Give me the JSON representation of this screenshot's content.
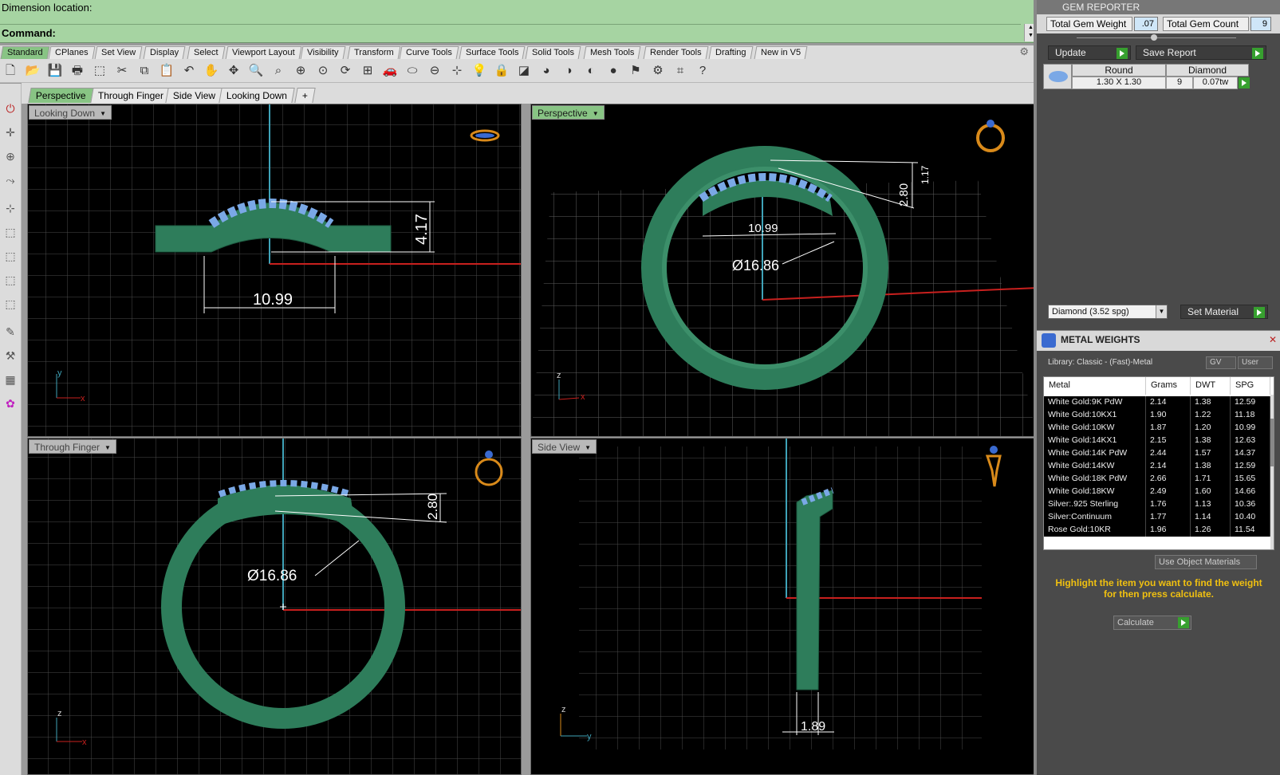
{
  "command_area": {
    "line1": "Dimension location:",
    "line2": "Command:"
  },
  "toolbar_tabs": [
    "Standard",
    "CPlanes",
    "Set View",
    "Display",
    "Select",
    "Viewport Layout",
    "Visibility",
    "Transform",
    "Curve Tools",
    "Surface Tools",
    "Solid Tools",
    "Mesh Tools",
    "Render Tools",
    "Drafting",
    "New in V5"
  ],
  "viewport_tabs": [
    "Perspective",
    "Through Finger",
    "Side View",
    "Looking Down",
    "+"
  ],
  "viewports": {
    "looking_down": {
      "label": "Looking Down",
      "dims": {
        "height": "4.17",
        "width": "10.99"
      }
    },
    "perspective": {
      "label": "Perspective",
      "dims": {
        "top": "1.17",
        "side": "2.80",
        "width": "10.99",
        "diameter": "Ø16.86"
      }
    },
    "through_finger": {
      "label": "Through Finger",
      "dims": {
        "side": "2.80",
        "diameter": "Ø16.86"
      }
    },
    "side_view": {
      "label": "Side View",
      "dims": {
        "thickness": "1.89"
      }
    }
  },
  "gem_reporter": {
    "title": "GEM REPORTER",
    "total_gem_weight_label": "Total Gem Weight",
    "total_gem_weight_value": ".07",
    "total_gem_count_label": "Total Gem Count",
    "total_gem_count_value": "9",
    "update_label": "Update",
    "save_report_label": "Save Report",
    "table_headers": [
      "Round",
      "Diamond"
    ],
    "row": {
      "size": "1.30 X 1.30",
      "count": "9",
      "weight": "0.07tw"
    },
    "material_select": "Diamond    (3.52 spg)",
    "set_material_label": "Set Material"
  },
  "metal_weights": {
    "title": "METAL WEIGHTS",
    "library": "Library: Classic - (Fast)-Metal",
    "gv_label": "GV",
    "user_label": "User",
    "headers": [
      "Metal",
      "Grams",
      "DWT",
      "SPG"
    ],
    "rows": [
      [
        "White Gold:9K PdW",
        "2.14",
        "1.38",
        "12.59"
      ],
      [
        "White Gold:10KX1",
        "1.90",
        "1.22",
        "11.18"
      ],
      [
        "White Gold:10KW",
        "1.87",
        "1.20",
        "10.99"
      ],
      [
        "White Gold:14KX1",
        "2.15",
        "1.38",
        "12.63"
      ],
      [
        "White Gold:14K PdW",
        "2.44",
        "1.57",
        "14.37"
      ],
      [
        "White Gold:14KW",
        "2.14",
        "1.38",
        "12.59"
      ],
      [
        "White Gold:18K PdW",
        "2.66",
        "1.71",
        "15.65"
      ],
      [
        "White Gold:18KW",
        "2.49",
        "1.60",
        "14.66"
      ],
      [
        "Silver:.925 Sterling",
        "1.76",
        "1.13",
        "10.36"
      ],
      [
        "Silver:Continuum",
        "1.77",
        "1.14",
        "10.40"
      ],
      [
        "Rose Gold:10KR",
        "1.96",
        "1.26",
        "11.54"
      ]
    ],
    "use_object_materials": "Use Object Materials",
    "help_text": "Highlight the item you want to find the weight for then press calculate.",
    "calculate_label": "Calculate"
  },
  "colors": {
    "ring_green": "#2e7d5b",
    "gem_blue": "#7aa8e6",
    "command_green": "#a6d4a2",
    "active_tab": "#88c484",
    "grid_line": "#4a4a4a",
    "x_axis": "#c8201e",
    "y_axis": "#3fa3b8"
  },
  "icons": [
    "new-icon",
    "open-icon",
    "save-icon",
    "print-icon",
    "cut-icon",
    "copy-icon",
    "paste-icon",
    "undo-icon",
    "pan-icon",
    "zoom-icon",
    "render-icon",
    "help-icon"
  ]
}
